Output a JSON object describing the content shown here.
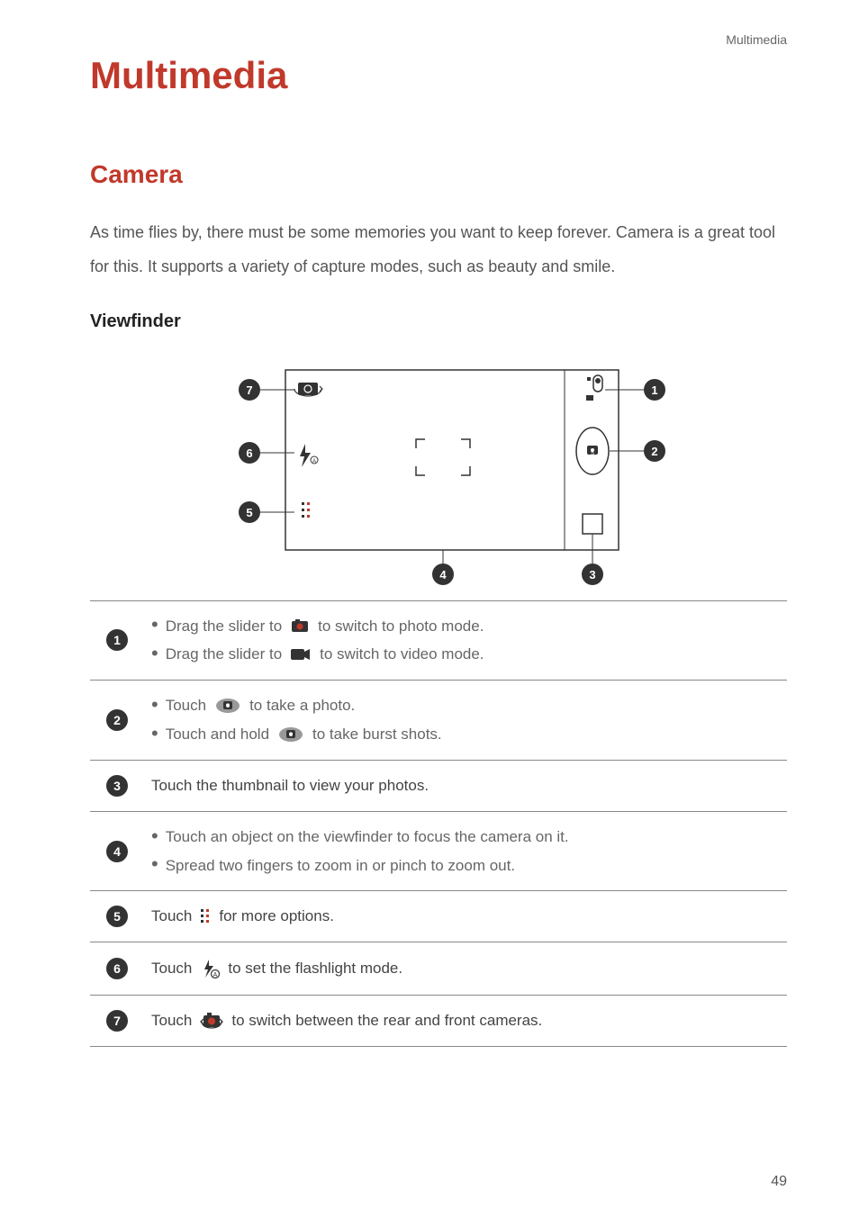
{
  "header": {
    "section_label": "Multimedia"
  },
  "title": "Multimedia",
  "section": "Camera",
  "intro": "As time flies by, there must be some memories you want to keep forever. Camera is a great tool for this. It supports a variety of capture modes, such as beauty and smile.",
  "subheading": "Viewfinder",
  "diagram": {
    "callouts": [
      "1",
      "2",
      "3",
      "4",
      "5",
      "6",
      "7"
    ],
    "icons": {
      "switch_camera": "switch-camera-icon",
      "flash": "flash-auto-icon",
      "more": "more-icon",
      "shutter": "shutter-icon",
      "gallery": "gallery-thumb-icon",
      "slider_photo": "camera-mode-icon",
      "slider_video": "video-mode-icon",
      "auto_label": "A"
    }
  },
  "rows": [
    {
      "num": "1",
      "lines": [
        {
          "pre": "Drag the slider to ",
          "icon": "camera-mode-icon",
          "post": " to switch to photo mode."
        },
        {
          "pre": "Drag the slider to ",
          "icon": "video-mode-icon",
          "post": " to switch to video mode."
        }
      ]
    },
    {
      "num": "2",
      "lines": [
        {
          "pre": "Touch ",
          "icon": "shutter-small-icon",
          "post": " to take a photo."
        },
        {
          "pre": "Touch and hold ",
          "icon": "shutter-small-icon",
          "post": " to take burst shots."
        }
      ]
    },
    {
      "num": "3",
      "plain": "Touch the thumbnail to view your photos."
    },
    {
      "num": "4",
      "lines": [
        {
          "pre": "Touch an object on the viewfinder to focus the camera on it.",
          "icon": null,
          "post": ""
        },
        {
          "pre": "Spread two fingers to zoom in or pinch to zoom out.",
          "icon": null,
          "post": ""
        }
      ]
    },
    {
      "num": "5",
      "mixed": {
        "pre": "Touch ",
        "icon": "more-icon",
        "post": " for more options."
      }
    },
    {
      "num": "6",
      "mixed": {
        "pre": "Touch ",
        "icon": "flash-auto-icon",
        "post": " to set the flashlight mode."
      }
    },
    {
      "num": "7",
      "mixed": {
        "pre": "Touch ",
        "icon": "switch-camera-icon",
        "post": " to switch between the rear and front cameras."
      }
    }
  ],
  "page_number": "49"
}
